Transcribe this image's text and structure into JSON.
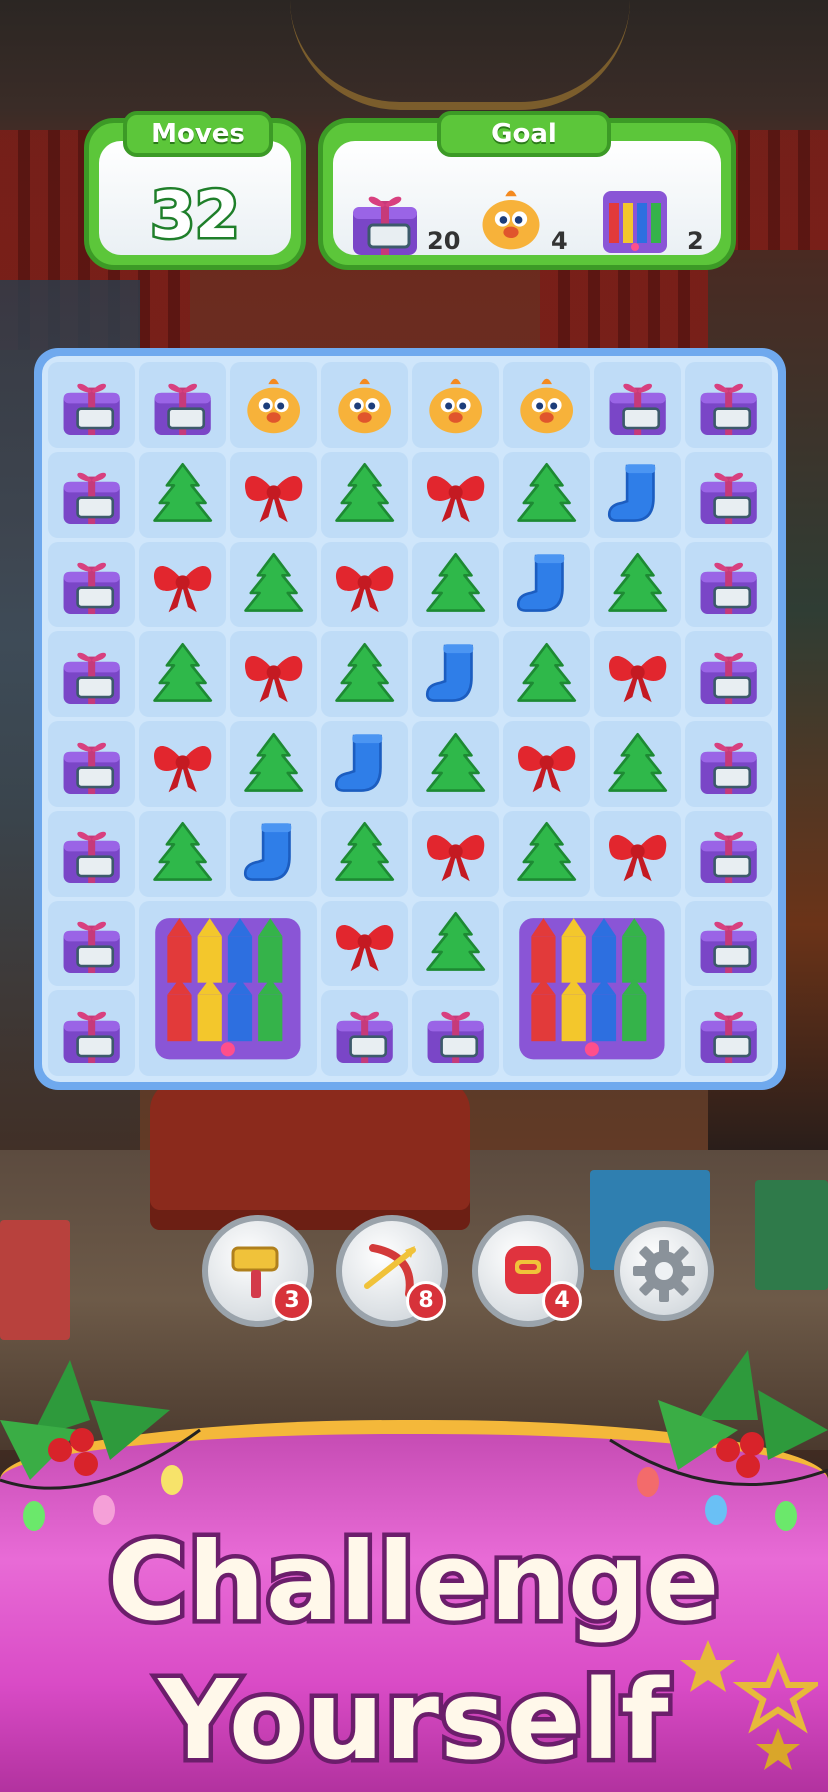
{
  "hud": {
    "moves_label": "Moves",
    "moves_value": "32",
    "goal_label": "Goal",
    "goals": [
      {
        "icon": "gift-box-icon",
        "count": "20"
      },
      {
        "icon": "chick-icon",
        "count": "4"
      },
      {
        "icon": "crayon-box-icon",
        "count": "2"
      }
    ]
  },
  "board": {
    "rows": [
      [
        "gift",
        "gift",
        "chick",
        "chick",
        "chick",
        "chick",
        "gift",
        "gift"
      ],
      [
        "gift",
        "tree",
        "bow",
        "tree",
        "bow",
        "tree",
        "sock",
        "gift"
      ],
      [
        "gift",
        "bow",
        "tree",
        "bow",
        "tree",
        "sock",
        "tree",
        "gift"
      ],
      [
        "gift",
        "tree",
        "bow",
        "tree",
        "sock",
        "tree",
        "bow",
        "gift"
      ],
      [
        "gift",
        "bow",
        "tree",
        "sock",
        "tree",
        "bow",
        "tree",
        "gift"
      ],
      [
        "gift",
        "tree",
        "sock",
        "tree",
        "bow",
        "tree",
        "bow",
        "gift"
      ],
      [
        "gift",
        "crayons",
        "crayons",
        "bow",
        "tree",
        "crayons",
        "crayons",
        "gift"
      ],
      [
        "gift",
        "crayons",
        "crayons",
        "gift",
        "gift",
        "crayons",
        "crayons",
        "gift"
      ]
    ]
  },
  "boosters": [
    {
      "icon": "hammer-icon",
      "count": "3"
    },
    {
      "icon": "crossbow-icon",
      "count": "8"
    },
    {
      "icon": "boxing-glove-icon",
      "count": "4"
    },
    {
      "icon": "settings-gear-icon"
    }
  ],
  "colors": {
    "hud_green": "#5cc63a",
    "board_blue": "#6fa9ee",
    "banner_magenta": "#e86bd6",
    "headline_outline": "#6b1e6b"
  },
  "banner": {
    "line1": "Challenge",
    "line2": "Yourself"
  }
}
